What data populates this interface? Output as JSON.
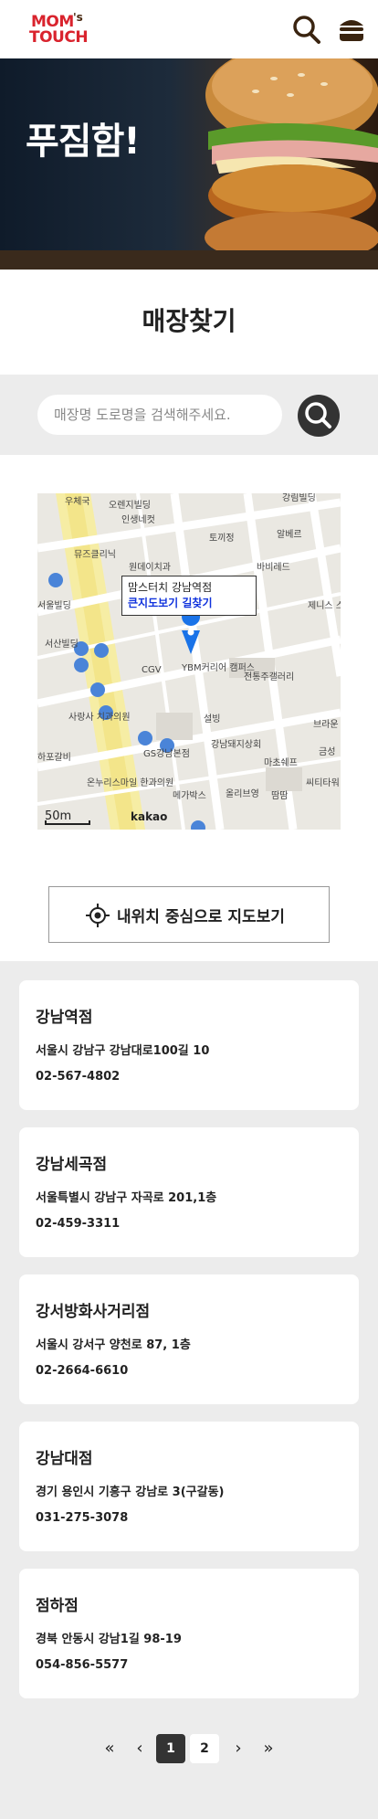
{
  "header": {
    "logo_line1": "MOM",
    "logo_line2": "TOUCH",
    "logo_apos": "'s",
    "icons": [
      "search-icon",
      "hamburger-menu-icon"
    ]
  },
  "hero": {
    "title": "푸짐함!"
  },
  "section": {
    "title": "매장찾기"
  },
  "search": {
    "placeholder": "매장명 도로명을 검색해주세요."
  },
  "map": {
    "popup_store": "맘스터치 강남역점",
    "popup_link": "큰지도보기 길찾기",
    "scale_label": "50m",
    "provider": "kakao",
    "labels": [
      "우체국",
      "오렌지빌딩",
      "인생네컷",
      "토끼정",
      "강림빌딩",
      "알베르",
      "뮤즈클리닉",
      "원데이치과",
      "바비레드",
      "서울빌딩",
      "제니스 스튜디오",
      "서산빌딩",
      "CGV",
      "YBM커리어 캠퍼스",
      "전통주갤러리",
      "사랑사 치과의원",
      "설빙",
      "브라운",
      "GS강남본점",
      "강남돼지상회",
      "금성",
      "마초쉐프",
      "온누리스마일 한과의원",
      "메가박스",
      "올리브영",
      "땀땀",
      "씨티타워",
      "하포갈비"
    ]
  },
  "locate_button": {
    "label": "내위치 중심으로 지도보기"
  },
  "stores": [
    {
      "name": "강남역점",
      "address": "서울시 강남구 강남대로100길 10",
      "phone": "02-567-4802"
    },
    {
      "name": "강남세곡점",
      "address": "서울특별시 강남구 자곡로 201,1층",
      "phone": "02-459-3311"
    },
    {
      "name": "강서방화사거리점",
      "address": "서울시 강서구 양천로 87, 1층",
      "phone": "02-2664-6610"
    },
    {
      "name": "강남대점",
      "address": "경기 용인시 기흥구 강남로 3(구갈동)",
      "phone": "031-275-3078"
    },
    {
      "name": "점하점",
      "address": "경북 안동시 강남1길 98-19",
      "phone": "054-856-5577"
    }
  ],
  "pagination": {
    "first": "«",
    "prev": "‹",
    "pages": [
      "1",
      "2"
    ],
    "current": "1",
    "next": "›",
    "last": "»"
  },
  "colors": {
    "brand": "#d9232d",
    "dark": "#333333",
    "band": "#ececec",
    "link": "#1133dd",
    "pin": "#1a73e8"
  }
}
